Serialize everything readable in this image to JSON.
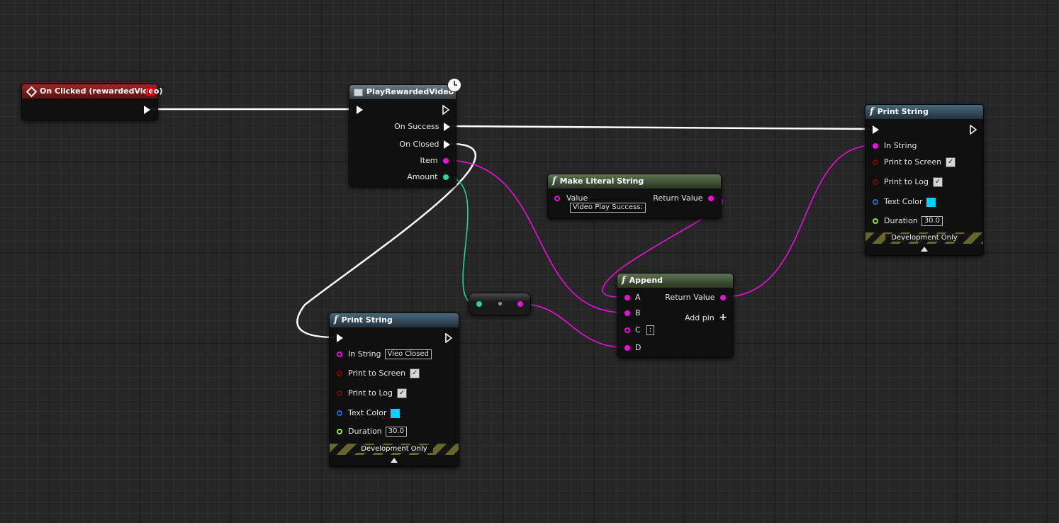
{
  "nodes": {
    "on_clicked": {
      "title": "On Clicked (rewardedVideo)"
    },
    "play_rewarded": {
      "title": "PlayRewardedVideo",
      "outputs": [
        "On Success",
        "On Closed",
        "Item",
        "Amount"
      ]
    },
    "make_literal": {
      "title": "Make Literal String",
      "input_label": "Value",
      "input_value": "Video Play Success:",
      "output_label": "Return Value"
    },
    "append": {
      "title": "Append",
      "inputs": [
        "A",
        "B",
        "C",
        "D"
      ],
      "c_value": ":",
      "output_label": "Return Value",
      "add_pin": "Add pin"
    },
    "print_string_top": {
      "title": "Print String",
      "in_string": "In String",
      "print_to_screen": "Print to Screen",
      "print_to_log": "Print to Log",
      "text_color": "Text Color",
      "duration": "Duration",
      "duration_value": "30.0",
      "dev_only": "Development Only"
    },
    "print_string_bottom": {
      "title": "Print String",
      "in_string": "In String",
      "in_string_value": "Vieo Closed",
      "print_to_screen": "Print to Screen",
      "print_to_log": "Print to Log",
      "text_color": "Text Color",
      "duration": "Duration",
      "duration_value": "30.0",
      "dev_only": "Development Only"
    }
  },
  "colors": {
    "exec_wire": "#ffffff",
    "string_wire": "#f00ce0",
    "int_wire": "#1ed7a0",
    "text_color_swatch": "#00d2ff"
  },
  "icons": [
    "event-diamond-icon",
    "function-icon",
    "latent-clock-icon",
    "exec-pin-icon",
    "add-pin-icon",
    "collapse-arrow-icon"
  ]
}
